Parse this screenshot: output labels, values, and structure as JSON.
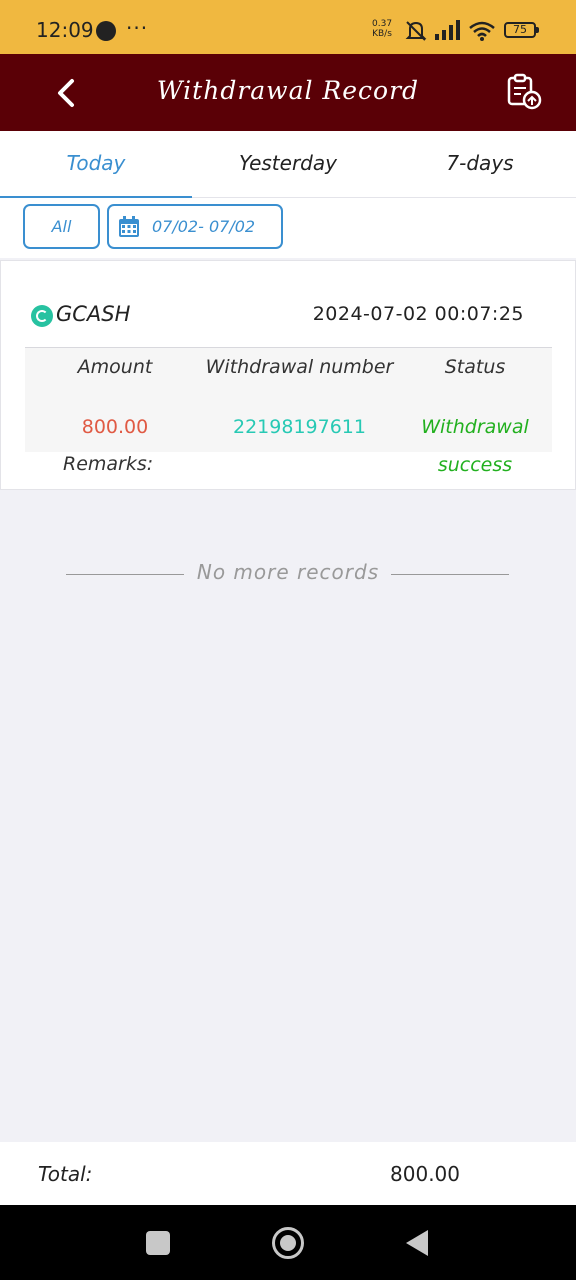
{
  "status_bar": {
    "time": "12:09",
    "dots": "···",
    "net_speed_value": "0.37",
    "net_speed_unit": "KB/s",
    "battery": "75"
  },
  "header": {
    "title": "Withdrawal Record"
  },
  "tabs": [
    {
      "label": "Today",
      "active": true
    },
    {
      "label": "Yesterday",
      "active": false
    },
    {
      "label": "7-days",
      "active": false
    }
  ],
  "filters": {
    "all_label": "All",
    "date_range": "07/02- 07/02"
  },
  "record": {
    "method": "GCASH",
    "datetime": "2024-07-02  00:07:25",
    "headers": {
      "amount": "Amount",
      "number": "Withdrawal  number",
      "status": "Status"
    },
    "amount": "800.00",
    "withdrawal_number": "22198197611",
    "status_line1": "Withdrawal",
    "status_line2": "success",
    "remarks_label": "Remarks:"
  },
  "no_more": "No  more  records",
  "footer": {
    "total_label": "Total:",
    "total_value": "800.00"
  },
  "colors": {
    "header_bg": "#5a0006",
    "status_bar_bg": "#f0b840",
    "accent": "#3a8fd0",
    "amount": "#e05a44",
    "number": "#27c9b4",
    "success": "#22b01f"
  }
}
